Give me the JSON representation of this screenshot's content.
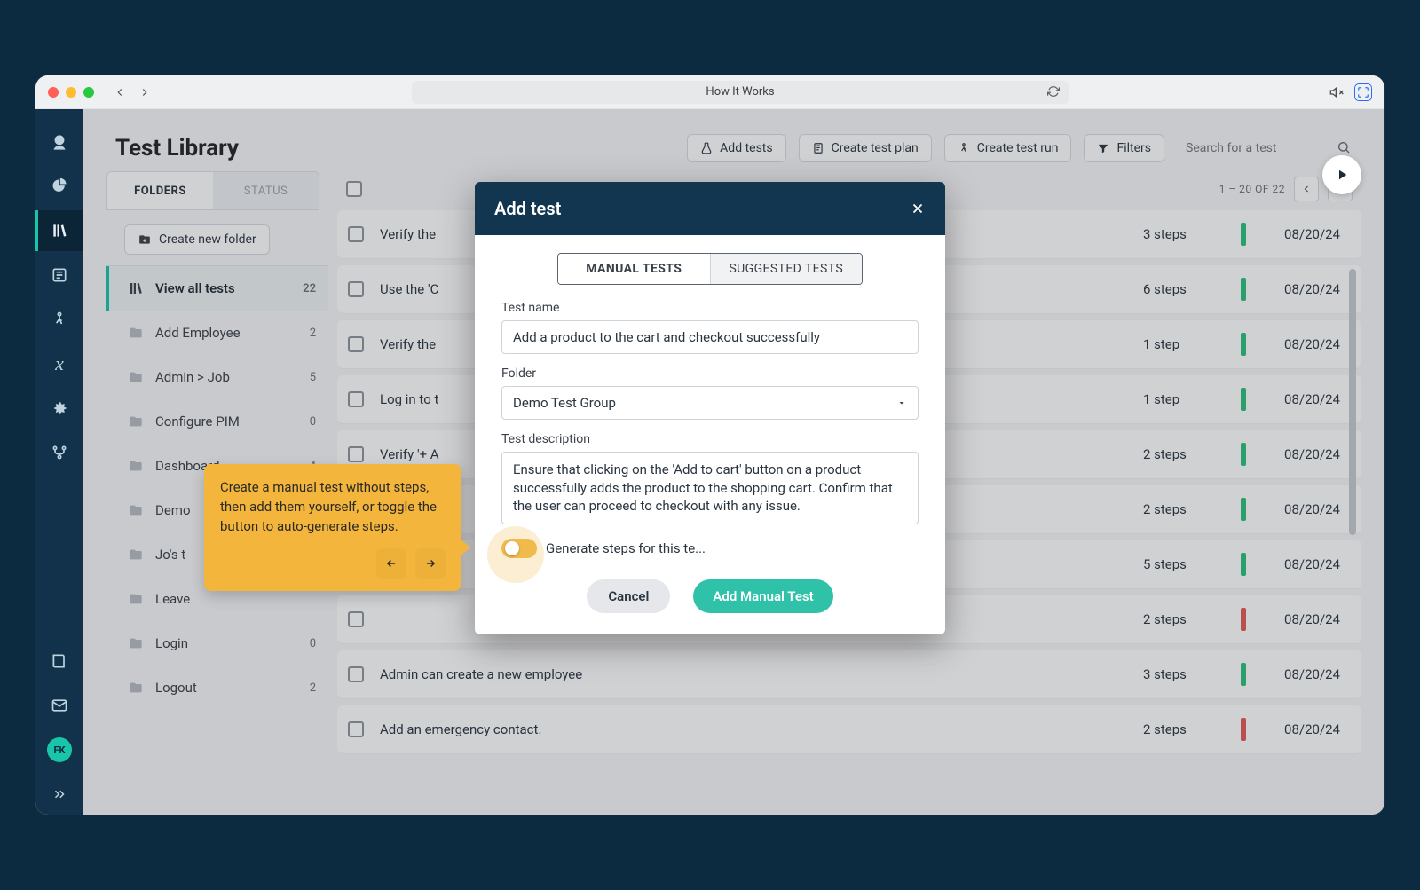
{
  "browser": {
    "title": "How It Works"
  },
  "page": {
    "title": "Test Library",
    "buttons": {
      "add_tests": "Add tests",
      "create_plan": "Create test plan",
      "create_run": "Create test run",
      "filters": "Filters"
    },
    "search_placeholder": "Search for a test",
    "pagination": "1 – 20 OF 22"
  },
  "fab": {
    "name": "play"
  },
  "sidebar_rail": {
    "avatar_initials": "FK"
  },
  "folder_panel": {
    "tabs": {
      "folders": "FOLDERS",
      "status": "STATUS"
    },
    "create_label": "Create new folder",
    "items": [
      {
        "label": "View all tests",
        "count": "22",
        "active": true,
        "icon": "books"
      },
      {
        "label": "Add Employee",
        "count": "2"
      },
      {
        "label": "Admin > Job",
        "count": "5"
      },
      {
        "label": "Configure PIM",
        "count": "0"
      },
      {
        "label": "Dashboard",
        "count": "4"
      },
      {
        "label": "Demo",
        "count": ""
      },
      {
        "label": "Jo's t",
        "count": ""
      },
      {
        "label": "Leave",
        "count": ""
      },
      {
        "label": "Login",
        "count": "0"
      },
      {
        "label": "Logout",
        "count": "2"
      }
    ]
  },
  "rows": [
    {
      "name": "Verify the",
      "steps": "3 steps",
      "status": "green",
      "date": "08/20/24"
    },
    {
      "name": "Use the 'C",
      "steps": "6 steps",
      "status": "green",
      "date": "08/20/24"
    },
    {
      "name": "Verify the",
      "steps": "1 step",
      "status": "green",
      "date": "08/20/24"
    },
    {
      "name": "Log in to t",
      "steps": "1 step",
      "status": "green",
      "date": "08/20/24"
    },
    {
      "name": "Verify '+ A",
      "steps": "2 steps",
      "status": "green",
      "date": "08/20/24"
    },
    {
      "name": "",
      "steps": "2 steps",
      "status": "green",
      "date": "08/20/24"
    },
    {
      "name": "",
      "steps": "5 steps",
      "status": "green",
      "date": "08/20/24"
    },
    {
      "name": "",
      "steps": "2 steps",
      "status": "red",
      "date": "08/20/24"
    },
    {
      "name": "Admin can create a new employee",
      "steps": "3 steps",
      "status": "green",
      "date": "08/20/24"
    },
    {
      "name": "Add an emergency contact.",
      "steps": "2 steps",
      "status": "red",
      "date": "08/20/24"
    }
  ],
  "modal": {
    "title": "Add test",
    "tabs": {
      "manual": "MANUAL TESTS",
      "suggested": "SUGGESTED TESTS"
    },
    "labels": {
      "name": "Test name",
      "folder": "Folder",
      "description": "Test description"
    },
    "values": {
      "name": "Add a product to the cart and checkout successfully",
      "folder": "Demo Test Group",
      "description": "Ensure that clicking on the 'Add to cart' button on a product successfully adds the product to the shopping cart. Confirm that the user can proceed to checkout with any issue."
    },
    "toggle_label": "Generate steps for this te...",
    "actions": {
      "cancel": "Cancel",
      "primary": "Add Manual Test"
    }
  },
  "coach": {
    "text": "Create a manual test without steps, then add them yourself, or toggle the button to auto-generate steps."
  }
}
